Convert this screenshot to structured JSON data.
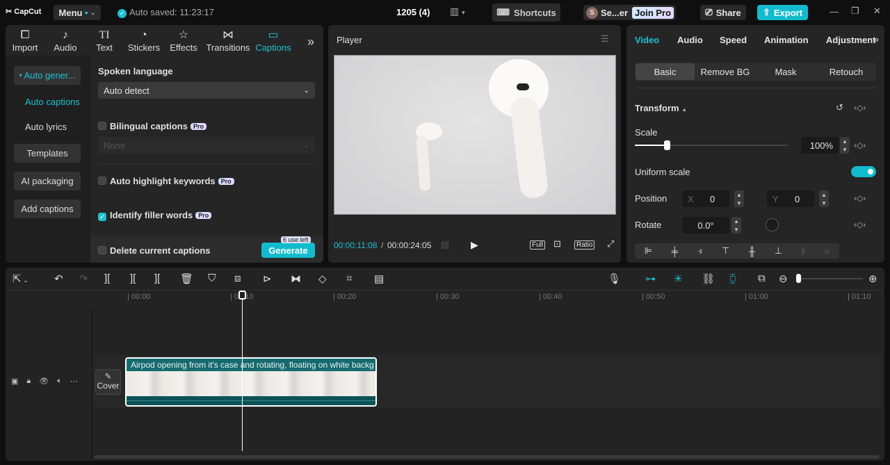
{
  "titlebar": {
    "logo": "CapCut",
    "menu": "Menu",
    "autosave": "Auto saved: 11:23:17",
    "project": "1205 (4)",
    "shortcuts": "Shortcuts",
    "user_initial": "S",
    "user": "Se...er",
    "join_pro": "Join Pro",
    "share": "Share",
    "export": "Export"
  },
  "media_tabs": [
    {
      "label": "Import",
      "icon": "import-icon"
    },
    {
      "label": "Audio",
      "icon": "audio-icon"
    },
    {
      "label": "Text",
      "icon": "text-icon"
    },
    {
      "label": "Stickers",
      "icon": "sticker-icon"
    },
    {
      "label": "Effects",
      "icon": "effects-icon"
    },
    {
      "label": "Transitions",
      "icon": "transitions-icon"
    },
    {
      "label": "Captions",
      "icon": "captions-icon"
    }
  ],
  "captions_sidebar": {
    "auto_generate": "Auto gener...",
    "auto_captions": "Auto captions",
    "auto_lyrics": "Auto lyrics",
    "templates": "Templates",
    "ai_packaging": "AI packaging",
    "add_captions": "Add captions"
  },
  "captions_panel": {
    "spoken_language_label": "Spoken language",
    "spoken_language": "Auto detect",
    "bilingual": "Bilingual captions",
    "bilingual_select": "None",
    "highlight": "Auto highlight keywords",
    "filler": "Identify filler words",
    "pro": "Pro",
    "delete_current": "Delete current captions",
    "uses_left": "6 use left",
    "generate": "Generate"
  },
  "player": {
    "title": "Player",
    "current_time": "00:00:11:08",
    "total_time": "00:00:24:05",
    "full": "Full",
    "ratio": "Ratio"
  },
  "inspector": {
    "tabs": [
      "Video",
      "Audio",
      "Speed",
      "Animation",
      "Adjustment"
    ],
    "subtabs": [
      "Basic",
      "Remove BG",
      "Mask",
      "Retouch"
    ],
    "transform": "Transform",
    "scale_label": "Scale",
    "scale_value": "100%",
    "scale_percent": 100,
    "uniform_scale": "Uniform scale",
    "uniform_on": true,
    "position_label": "Position",
    "x_label": "X",
    "x": "0",
    "y_label": "Y",
    "y": "0",
    "rotate_label": "Rotate",
    "rotate": "0.0°"
  },
  "timeline": {
    "ticks": [
      "00:00",
      "00:10",
      "00:20",
      "00:30",
      "00:40",
      "00:50",
      "01:00",
      "01:10"
    ],
    "cover": "Cover",
    "clip_title": "Airpod opening from it's case and rotating, floating on white backg"
  }
}
